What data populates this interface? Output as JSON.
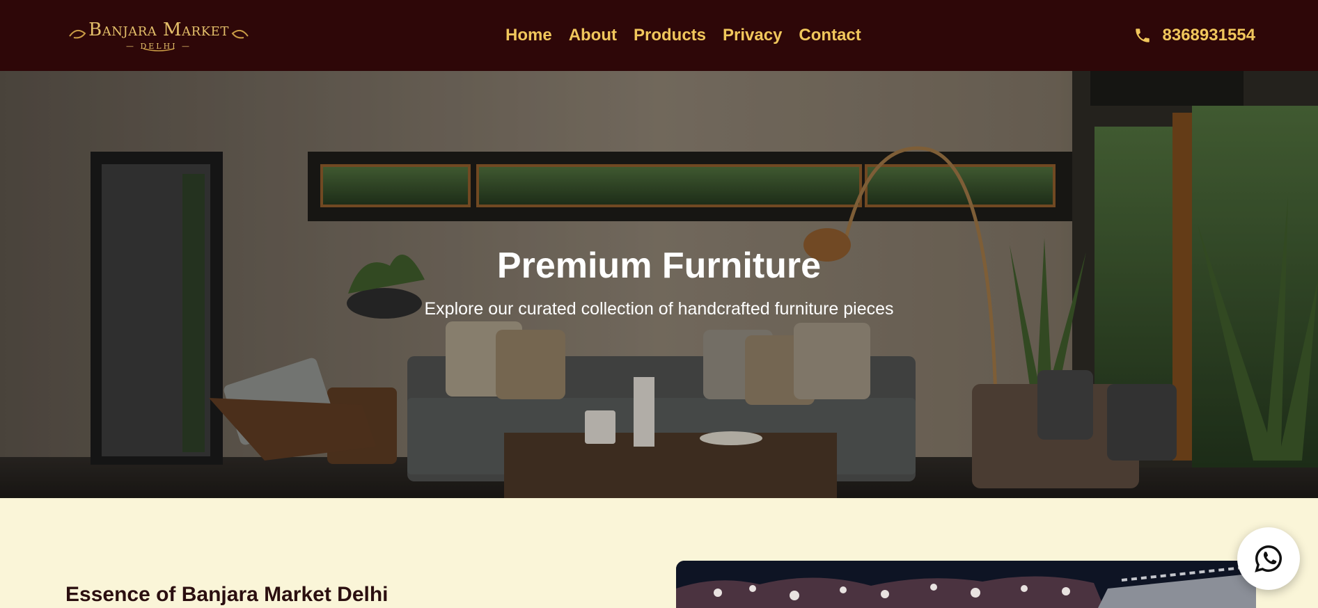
{
  "brand": {
    "logo_main": "Banjara Market",
    "logo_sub": "— DELHI —"
  },
  "nav": {
    "items": [
      "Home",
      "About",
      "Products",
      "Privacy",
      "Contact"
    ]
  },
  "contact": {
    "phone": "8368931554",
    "icon": "phone-icon"
  },
  "hero": {
    "title": "Premium Furniture",
    "subtitle": "Explore our curated collection of handcrafted furniture pieces"
  },
  "essence": {
    "title": "Essence of Banjara Market Delhi"
  },
  "whatsapp": {
    "icon": "whatsapp-icon"
  },
  "colors": {
    "header_bg": "#2e0708",
    "accent": "#f1c75c",
    "page_bg": "#faf5d8"
  }
}
